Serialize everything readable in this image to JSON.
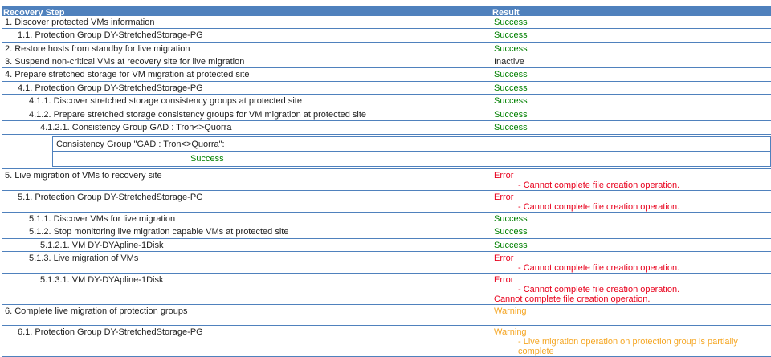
{
  "header": {
    "step": "Recovery Step",
    "result": "Result"
  },
  "rows": [
    {
      "step": "1. Discover protected VMs information",
      "status": "Success",
      "cls": "s",
      "level": 1,
      "h": 16
    },
    {
      "step": "1.1. Protection Group DY-StretchedStorage-PG",
      "status": "Success",
      "cls": "s",
      "level": 2,
      "h": 17
    },
    {
      "step": "2. Restore hosts from standby for live migration",
      "status": "Success",
      "cls": "s",
      "level": 1,
      "h": 16
    },
    {
      "step": "3. Suspend non-critical VMs at recovery site for live migration",
      "status": "Inactive",
      "cls": "i",
      "level": 1,
      "h": 16
    },
    {
      "step": "4. Prepare stretched storage for VM migration at protected site",
      "status": "Success",
      "cls": "s",
      "level": 1,
      "h": 17
    },
    {
      "step": "4.1. Protection Group DY-StretchedStorage-PG",
      "status": "Success",
      "cls": "s",
      "level": 2,
      "h": 16
    },
    {
      "step": "4.1.1. Discover stretched storage consistency groups at protected site",
      "status": "Success",
      "cls": "s",
      "level": 3,
      "h": 17
    },
    {
      "step": "4.1.2. Prepare stretched storage consistency groups for VM migration at protected site",
      "status": "Success",
      "cls": "s",
      "level": 3,
      "h": 16
    },
    {
      "step": "4.1.2.1. Consistency Group GAD : Tron<>Quorra",
      "status": "Success",
      "cls": "s",
      "level": 4,
      "h": 17,
      "nested": {
        "title": "Consistency Group \"GAD : Tron<>Quorra\":",
        "status": "Success"
      }
    },
    {
      "step": "5. Live migration of VMs to recovery site",
      "status": "Error",
      "cls": "e",
      "level": 1,
      "h": 26,
      "details": [
        "- Cannot complete file creation operation."
      ]
    },
    {
      "step": "5.1. Protection Group DY-StretchedStorage-PG",
      "status": "Error",
      "cls": "e",
      "level": 2,
      "h": 26,
      "details": [
        "- Cannot complete file creation operation."
      ]
    },
    {
      "step": "5.1.1. Discover VMs for live migration",
      "status": "Success",
      "cls": "s",
      "level": 3,
      "h": 16
    },
    {
      "step": "5.1.2. Stop monitoring live migration capable VMs at protected site",
      "status": "Success",
      "cls": "s",
      "level": 3,
      "h": 17
    },
    {
      "step": "5.1.2.1. VM DY-DYApline-1Disk",
      "status": "Success",
      "cls": "s",
      "level": 4,
      "h": 16
    },
    {
      "step": "5.1.3. Live migration of VMs",
      "status": "Error",
      "cls": "e",
      "level": 3,
      "h": 26,
      "details": [
        "- Cannot complete file creation operation."
      ]
    },
    {
      "step": "5.1.3.1. VM DY-DYApline-1Disk",
      "status": "Error",
      "cls": "e",
      "level": 4,
      "h": 37,
      "details": [
        "- Cannot complete file creation operation."
      ],
      "extra": "Cannot complete file creation operation."
    },
    {
      "step": "6. Complete live migration of protection groups",
      "status": "Warning",
      "cls": "w",
      "level": 1,
      "h": 26
    },
    {
      "step": "6.1. Protection Group DY-StretchedStorage-PG",
      "status": "Warning",
      "cls": "w",
      "level": 2,
      "h": 26,
      "details": [
        "- Live migration operation on protection group is partially complete"
      ]
    }
  ]
}
